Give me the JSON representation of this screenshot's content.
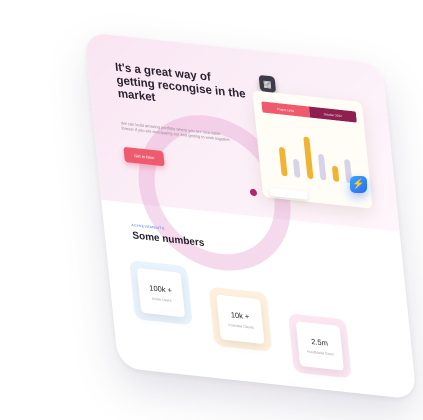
{
  "hero": {
    "title": "It's a great way of getting recongise in the market",
    "body": "We can build amazing portfolio where you are heardable forever if you are anticipating our and getting to work together",
    "cta_label": "Get in Now"
  },
  "dashboard": {
    "tab_left": "Project Links",
    "tab_right": "October 2022",
    "calendar_icon": "calendar-icon",
    "home_icon": "home-icon",
    "bars": [
      0.55,
      0.35,
      0.8,
      0.5,
      0.3,
      0.45
    ],
    "bar_colors": [
      "#f2b233",
      "#d8d4e8",
      "#f2b233",
      "#d8d4e8",
      "#f2b233",
      "#d8d4e8"
    ]
  },
  "numbers": {
    "eyebrow": "ACHIEVEMENTS",
    "title": "Some numbers",
    "stats": [
      {
        "value": "100k +",
        "label": "Active Users"
      },
      {
        "value": "10k +",
        "label": "Potential Clients"
      },
      {
        "value": "2.5m",
        "label": "Feedbacks Given"
      }
    ]
  },
  "badge": {
    "icon": "messenger-icon"
  },
  "colors": {
    "accent": "#ee5b6f",
    "tab_left": "#ee5b6f",
    "tab_right": "#8e1f4f",
    "badge": "#2a6cf0"
  }
}
